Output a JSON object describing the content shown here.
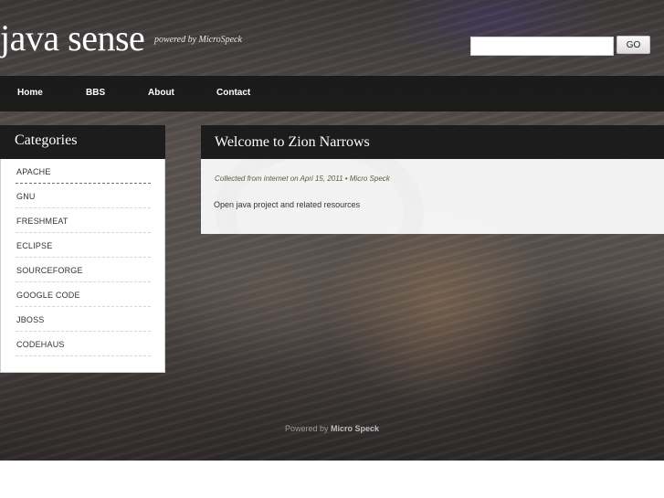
{
  "header": {
    "site_title": "java sense",
    "tagline": "powered by MicroSpeck"
  },
  "search": {
    "value": "",
    "placeholder": "",
    "button_label": "GO"
  },
  "nav": {
    "items": [
      {
        "label": "Home"
      },
      {
        "label": "BBS"
      },
      {
        "label": "About"
      },
      {
        "label": "Contact"
      }
    ]
  },
  "sidebar": {
    "title": "Categories",
    "categories": [
      {
        "label": "APACHE"
      },
      {
        "label": "GNU"
      },
      {
        "label": "FRESHMEAT"
      },
      {
        "label": "ECLIPSE"
      },
      {
        "label": "SOURCEFORGE"
      },
      {
        "label": "GOOGLE CODE"
      },
      {
        "label": "JBOSS"
      },
      {
        "label": "CODEHAUS"
      }
    ]
  },
  "post": {
    "title": "Welcome to Zion Narrows",
    "meta": "Collected from internet on Apri 15, 2011  •  Micro Speck",
    "body": "Open java project and related resources"
  },
  "footer": {
    "prefix": "Powered by",
    "brand": "Micro Speck"
  }
}
